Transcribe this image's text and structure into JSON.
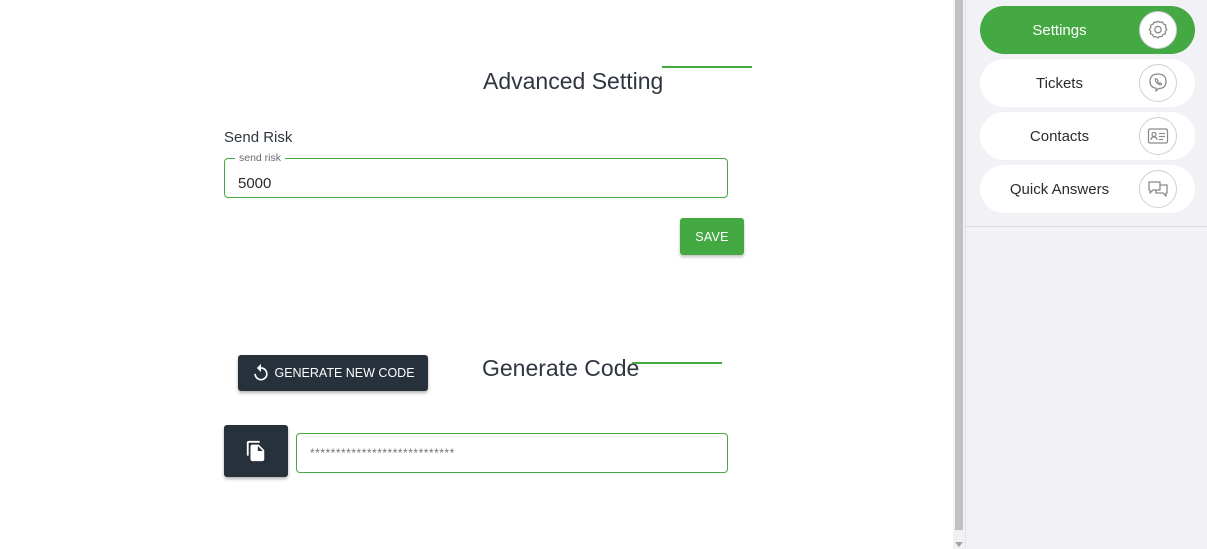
{
  "advanced": {
    "title": "Advanced Setting",
    "field_label": "Send Risk",
    "legend": "send risk",
    "value": "5000",
    "save_label": "SAVE"
  },
  "generate": {
    "title": "Generate Code",
    "button_label": "GENERATE NEW CODE",
    "code_placeholder": "****************************"
  },
  "sidebar": {
    "items": [
      {
        "label": "Settings",
        "icon": "gear-icon",
        "active": true
      },
      {
        "label": "Tickets",
        "icon": "viber-phone-icon",
        "active": false
      },
      {
        "label": "Contacts",
        "icon": "contact-card-icon",
        "active": false
      },
      {
        "label": "Quick Answers",
        "icon": "chat-bubbles-icon",
        "active": false
      }
    ]
  },
  "colors": {
    "accent": "#44a843",
    "dark_button": "#27313b",
    "sidebar_bg": "#f2f2f6"
  }
}
